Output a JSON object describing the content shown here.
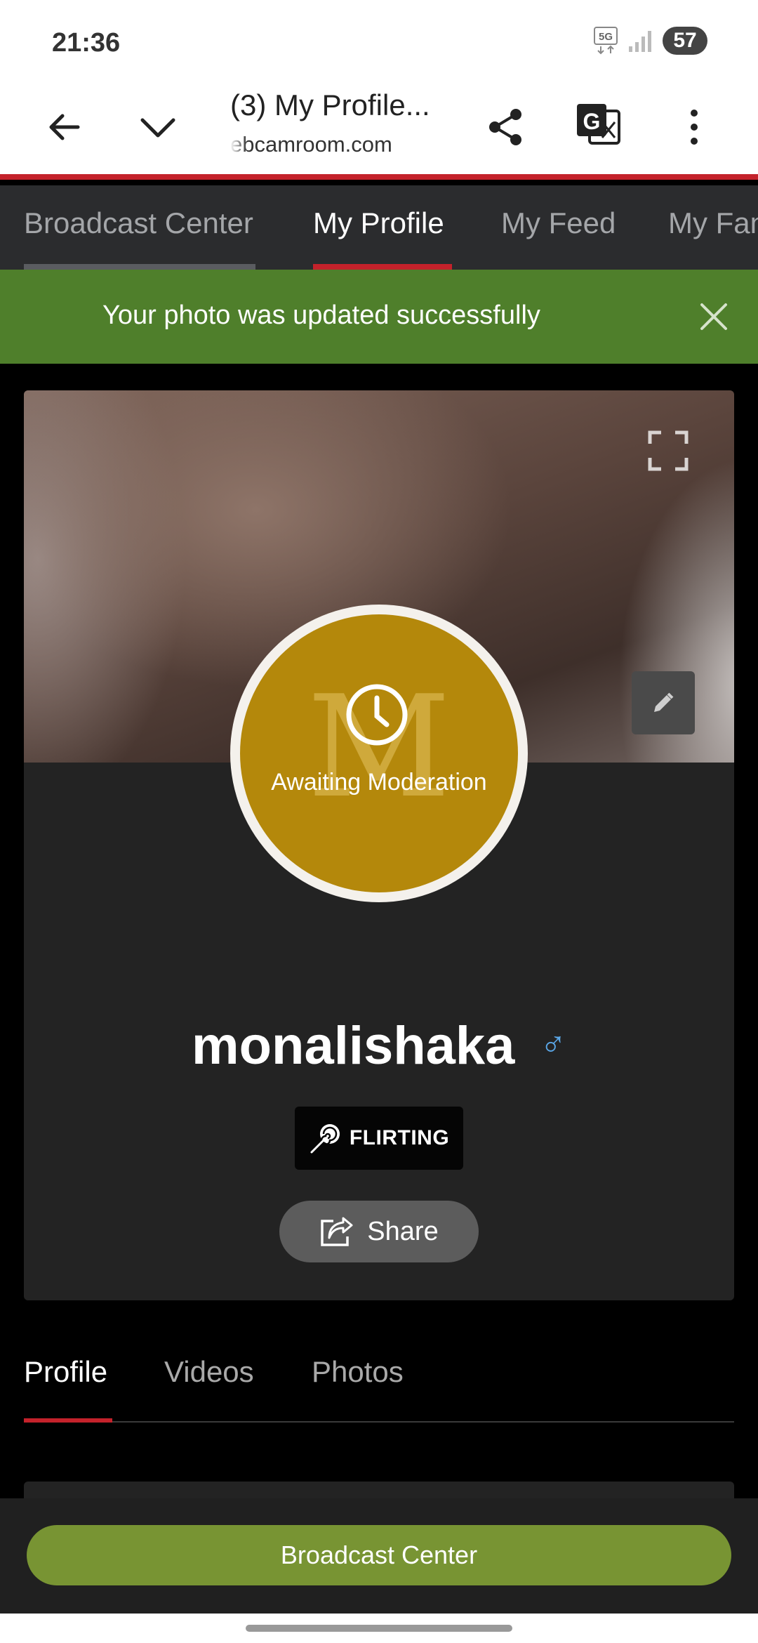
{
  "status_bar": {
    "time": "21:36",
    "network": "5G",
    "battery": "57"
  },
  "browser": {
    "page_title": "(3) My Profile...",
    "url": "ebcamroom.com",
    "icons": [
      "back-arrow-icon",
      "chevron-down-icon",
      "share-icon",
      "translate-icon",
      "more-vert-icon"
    ]
  },
  "site_nav": {
    "tabs": [
      {
        "label": "Broadcast Center",
        "state": "visited"
      },
      {
        "label": "My Profile",
        "state": "active"
      },
      {
        "label": "My Feed",
        "state": "normal"
      },
      {
        "label": "My Fan",
        "state": "normal"
      }
    ],
    "active_color": "#c4222b"
  },
  "banner": {
    "message": "Your photo was updated successfully",
    "color": "#4f7f2b"
  },
  "profile": {
    "avatar_letter": "M",
    "avatar_status": "Awaiting Moderation",
    "username": "monalishaka",
    "gender_symbol": "♂",
    "badge": "FLIRTING",
    "share_label": "Share",
    "avatar_color": "#b4880b"
  },
  "content_tabs": {
    "tabs": [
      {
        "label": "Profile",
        "active": true
      },
      {
        "label": "Videos",
        "active": false
      },
      {
        "label": "Photos",
        "active": false
      }
    ]
  },
  "bottom_cta": {
    "label": "Broadcast Center",
    "color": "#789433"
  }
}
